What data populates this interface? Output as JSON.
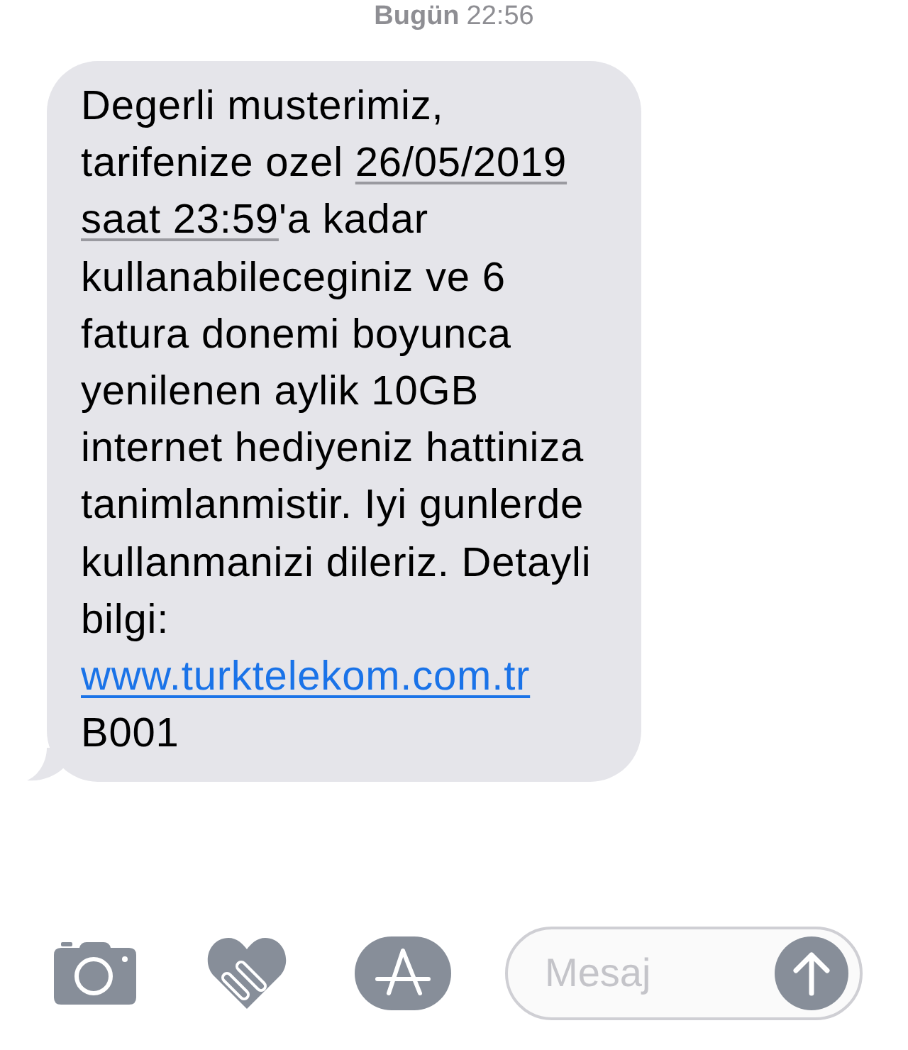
{
  "timestamp": {
    "day": "Bugün",
    "time": "22:56"
  },
  "message": {
    "segments": [
      {
        "kind": "text",
        "text": "Degerli musterimiz, tarifenize ozel "
      },
      {
        "kind": "date",
        "text": "26/05/2019 saat 23:59"
      },
      {
        "kind": "text",
        "text": "'a kadar kullanabileceginiz ve 6 fatura donemi boyunca yenilenen aylik 10GB internet hediyeniz hattiniza tanimlanmistir. Iyi gunlerde kullanmanizi dileriz. Detayli bilgi: "
      },
      {
        "kind": "url",
        "text": "www.turktelekom.com.tr"
      },
      {
        "kind": "text",
        "text": " B001"
      }
    ]
  },
  "composer": {
    "placeholder": "Mesaj"
  }
}
